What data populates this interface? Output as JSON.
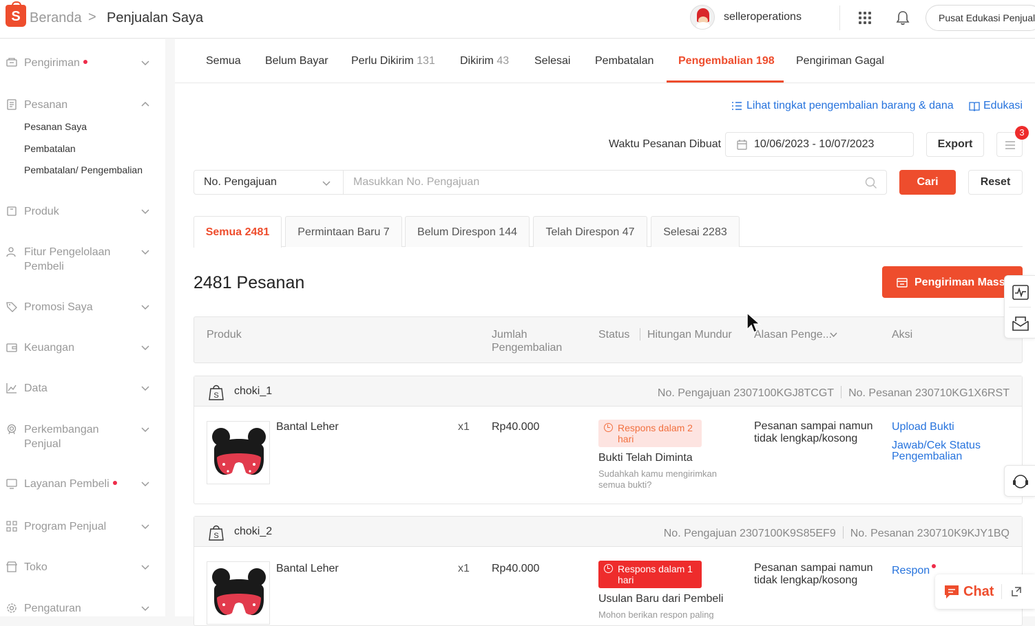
{
  "header": {
    "logo_letter": "S",
    "breadcrumb_home": "Beranda",
    "breadcrumb_sep": ">",
    "breadcrumb_current": "Penjualan Saya",
    "username": "selleroperations",
    "edu_button": "Pusat Edukasi Penjual"
  },
  "sidebar": {
    "pengiriman": "Pengiriman",
    "pesanan": "Pesanan",
    "pesanan_sub": [
      "Pesanan Saya",
      "Pembatalan",
      "Pembatalan/ Pengembalian"
    ],
    "produk": "Produk",
    "fitur_line1": "Fitur Pengelolaan",
    "fitur_line2": "Pembeli",
    "promosi": "Promosi Saya",
    "keuangan": "Keuangan",
    "data": "Data",
    "perkembangan_line1": "Perkembangan",
    "perkembangan_line2": "Penjual",
    "layanan": "Layanan Pembeli",
    "program": "Program Penjual",
    "toko": "Toko",
    "pengaturan": "Pengaturan"
  },
  "tabs": [
    {
      "label": "Semua",
      "count": ""
    },
    {
      "label": "Belum Bayar",
      "count": ""
    },
    {
      "label": "Perlu Dikirim",
      "count": "131"
    },
    {
      "label": "Dikirim",
      "count": "43"
    },
    {
      "label": "Selesai",
      "count": ""
    },
    {
      "label": "Pembatalan",
      "count": ""
    },
    {
      "label": "Pengembalian 198",
      "count": ""
    },
    {
      "label": "Pengiriman Gagal",
      "count": ""
    }
  ],
  "links": {
    "return_rate": "Lihat tingkat pengembalian barang & dana",
    "edukasi": "Edukasi"
  },
  "filters": {
    "date_label": "Waktu Pesanan Dibuat",
    "date_range": "10/06/2023 - 10/07/2023",
    "export": "Export",
    "list_badge": "3",
    "search_type": "No. Pengajuan",
    "search_placeholder": "Masukkan No. Pengajuan",
    "search_button": "Cari",
    "reset_button": "Reset"
  },
  "subtabs": [
    "Semua 2481",
    "Permintaan Baru 7",
    "Belum Direspon 144",
    "Telah Direspon 47",
    "Selesai 2283"
  ],
  "summary": {
    "count_title": "2481 Pesanan",
    "mass_ship_button": "Pengiriman Massal"
  },
  "table_headers": {
    "produk": "Produk",
    "jumlah_line1": "Jumlah",
    "jumlah_line2": "Pengembalian",
    "status": "Status",
    "countdown": "Hitungan Mundur",
    "alasan": "Alasan Penge...",
    "aksi": "Aksi"
  },
  "orders": [
    {
      "shop": "choki_1",
      "no_pengajuan": "No. Pengajuan 2307100KGJ8TCGT",
      "no_pesanan": "No. Pesanan 230710KG1X6RST",
      "product": "Bantal Leher",
      "qty": "x1",
      "price": "Rp40.000",
      "badge": "Respons dalam 2 hari",
      "status_title": "Bukti Telah Diminta",
      "status_hint": "Sudahkah kamu mengirimkan semua bukti?",
      "reason": "Pesanan sampai namun tidak lengkap/kosong",
      "action1": "Upload Bukti",
      "action2": "Jawab/Cek Status Pengembalian"
    },
    {
      "shop": "choki_2",
      "no_pengajuan": "No. Pengajuan 2307100K9S85EF9",
      "no_pesanan": "No. Pesanan 230710K9KJY1BQ",
      "product": "Bantal Leher",
      "qty": "x1",
      "price": "Rp40.000",
      "badge": "Respons dalam 1 hari",
      "status_title": "Usulan Baru dari Pembeli",
      "status_hint": "Mohon berikan respon paling",
      "reason": "Pesanan sampai namun tidak lengkap/kosong",
      "action1": "Respon"
    }
  ],
  "chat": {
    "label": "Chat"
  },
  "colors": {
    "brand": "#ee4d2d",
    "link": "#2673dd",
    "badge_light": "#fde4e1",
    "badge_solid": "#ee2c2c"
  }
}
